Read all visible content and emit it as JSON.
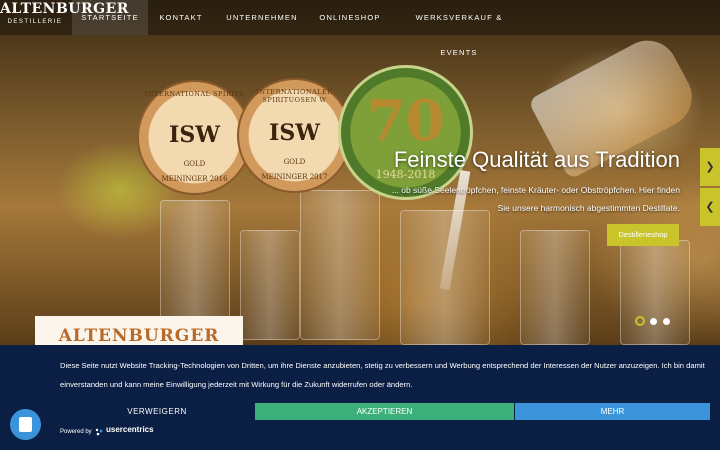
{
  "brand": {
    "name": "ALTENBURGER",
    "sub": "DESTILLERIE"
  },
  "nav": {
    "items": [
      "STARTSEITE",
      "KONTAKT",
      "UNTERNEHMEN",
      "ONLINESHOP",
      "WERKSVERKAUF & EVENTS"
    ],
    "active_index": 0
  },
  "medals": [
    {
      "top_text": "INTERNATIONAL SPIRITS",
      "logo": "ISW",
      "award": "GOLD",
      "year": "MEININGER 2016"
    },
    {
      "top_text": "INTERNATIONALER SPIRITUOSEN W",
      "logo": "ISW",
      "award": "GOLD",
      "year": "MEININGER 2017"
    },
    {
      "number": "70",
      "years": "1948-2018"
    }
  ],
  "slide": {
    "title": "Feinste Qualität aus Tradition",
    "text": "... ob süße Seelentröpfchen, feinste Kräuter- oder Obsttröpfchen. Hier finden Sie unsere harmonisch abgestimmten Destillate.",
    "button": "Destillerieshop"
  },
  "slider": {
    "next": "❯",
    "prev": "❮",
    "dots": 3,
    "active_dot": 0
  },
  "card": {
    "logo": "ALTENBURGER"
  },
  "consent": {
    "text": "Diese Seite nutzt Website Tracking-Technologien von Dritten, um ihre Dienste anzubieten, stetig zu verbessern und Werbung entsprechend der Interessen der Nutzer anzuzeigen. Ich bin damit einverstanden und kann meine Einwilligung jederzeit mit Wirkung für die Zukunft widerrufen oder ändern.",
    "deny": "VERWEIGERN",
    "accept": "AKZEPTIEREN",
    "more": "MEHR",
    "powered": "Powered by",
    "vendor": "usercentrics"
  },
  "colors": {
    "accent": "#c8c42a",
    "banner": "#0b1f44",
    "accept": "#3db07a",
    "more": "#3b94d9"
  }
}
